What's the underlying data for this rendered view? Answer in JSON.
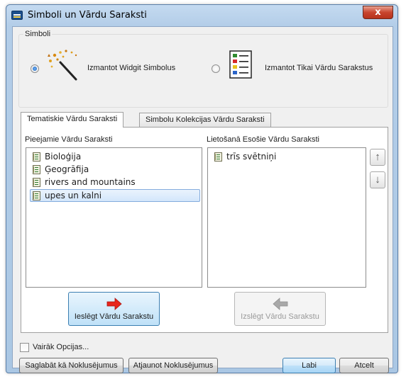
{
  "window": {
    "title": "Simboli un Vārdu Saraksti",
    "close_symbol": "x"
  },
  "symbols_group": {
    "legend": "Simboli",
    "option_widgit": {
      "label": "Izmantot Widgit Simbolus",
      "checked": true
    },
    "option_words": {
      "label": "Izmantot Tikai Vārdu Sarakstus",
      "checked": false
    }
  },
  "tabs": [
    {
      "label": "Tematiskie Vārdu Saraksti",
      "active": true
    },
    {
      "label": "Simbolu Kolekcijas Vārdu Saraksti",
      "active": false
    }
  ],
  "available": {
    "label": "Pieejamie Vārdu Saraksti",
    "items": [
      {
        "label": "Bioloģija",
        "selected": false
      },
      {
        "label": "Ģeogrāfija",
        "selected": false
      },
      {
        "label": "rivers and mountains",
        "selected": false
      },
      {
        "label": "upes un kalni",
        "selected": true
      }
    ]
  },
  "in_use": {
    "label": "Lietošanā Esošie Vārdu Saraksti",
    "items": [
      {
        "label": "trīs svētniņi"
      }
    ]
  },
  "move_buttons": {
    "up": "↑",
    "down": "↓"
  },
  "include_button": {
    "label": "Ieslēgt Vārdu Sarakstu",
    "icon": "arrow-right-icon",
    "color": "#e8261c"
  },
  "exclude_button": {
    "label": "Izslēgt Vārdu Sarakstu",
    "icon": "arrow-left-icon",
    "enabled": false
  },
  "more_options": {
    "label": "Vairāk Opcijas...",
    "checked": false
  },
  "footer": {
    "save_defaults": "Saglabāt kā Noklusējumus",
    "restore_defaults": "Atjaunot Noklusējumus",
    "ok": "Labi",
    "cancel": "Atcelt"
  },
  "colors": {
    "accent": "#3c7fb1",
    "titlebar": "#b3cde8",
    "close": "#c8452e"
  }
}
